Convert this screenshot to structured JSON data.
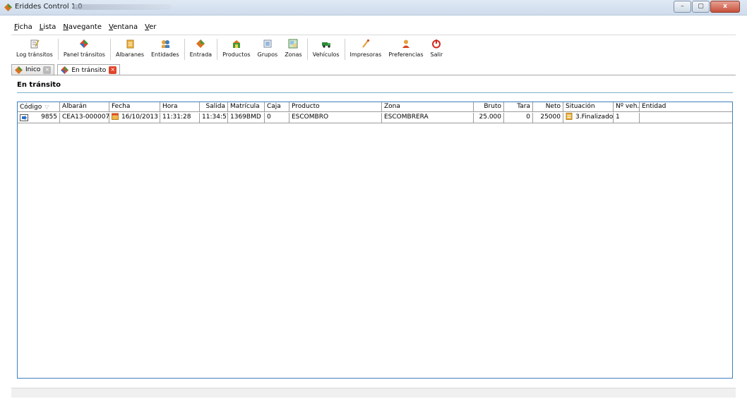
{
  "window": {
    "title": "Eriddes Control 1.0",
    "controls": {
      "minimize": "–",
      "maximize": "▢",
      "close": "x"
    }
  },
  "menu": [
    {
      "label": "Ficha",
      "accel": "F",
      "rest": "icha"
    },
    {
      "label": "Lista",
      "accel": "L",
      "rest": "ista"
    },
    {
      "label": "Navegante",
      "accel": "N",
      "rest": "avegante"
    },
    {
      "label": "Ventana",
      "accel": "V",
      "rest": "entana"
    },
    {
      "label": "Ver",
      "accel": "V",
      "rest": "er"
    }
  ],
  "toolbar": [
    {
      "label": "Log tránsitos",
      "icon": "log-icon"
    },
    {
      "label": "Panel tránsitos",
      "icon": "panel-icon"
    },
    {
      "label": "Albaranes",
      "icon": "albaranes-icon"
    },
    {
      "label": "Entidades",
      "icon": "entidades-icon"
    },
    {
      "label": "Entrada",
      "icon": "entrada-icon"
    },
    {
      "label": "Productos",
      "icon": "productos-icon"
    },
    {
      "label": "Grupos",
      "icon": "grupos-icon"
    },
    {
      "label": "Zonas",
      "icon": "zonas-icon"
    },
    {
      "label": "Vehículos",
      "icon": "vehiculos-icon"
    },
    {
      "label": "Impresoras",
      "icon": "impresoras-icon"
    },
    {
      "label": "Preferencias",
      "icon": "preferencias-icon"
    },
    {
      "label": "Salir",
      "icon": "salir-icon"
    }
  ],
  "tabs": [
    {
      "label": "Inico",
      "active": false
    },
    {
      "label": "En tránsito",
      "active": true
    }
  ],
  "section": {
    "title": "En tránsito"
  },
  "table": {
    "columns": [
      "Código",
      "Albarán",
      "Fecha",
      "Hora",
      "Salida",
      "Matrícula",
      "Caja",
      "Producto",
      "Zona",
      "Bruto",
      "Tara",
      "Neto",
      "Situación",
      "Nº veh.",
      "Entidad"
    ],
    "rows": [
      {
        "codigo": "9855",
        "albaran": "CEA13-000007",
        "fecha": "16/10/2013",
        "hora": "11:31:28",
        "salida": "11:34:57",
        "matricula": "1369BMD",
        "caja": "0",
        "producto": "ESCOMBRO",
        "zona": "ESCOMBRERA",
        "bruto": "25.000",
        "tara": "0",
        "neto": "25000",
        "situacion": "3.Finalizado",
        "nveh": "1",
        "entidad": ""
      }
    ]
  },
  "colors": {
    "accent_border": "#3f7fbf",
    "section_line": "#7fb1c8",
    "tab_close_active": "#e0442b"
  }
}
